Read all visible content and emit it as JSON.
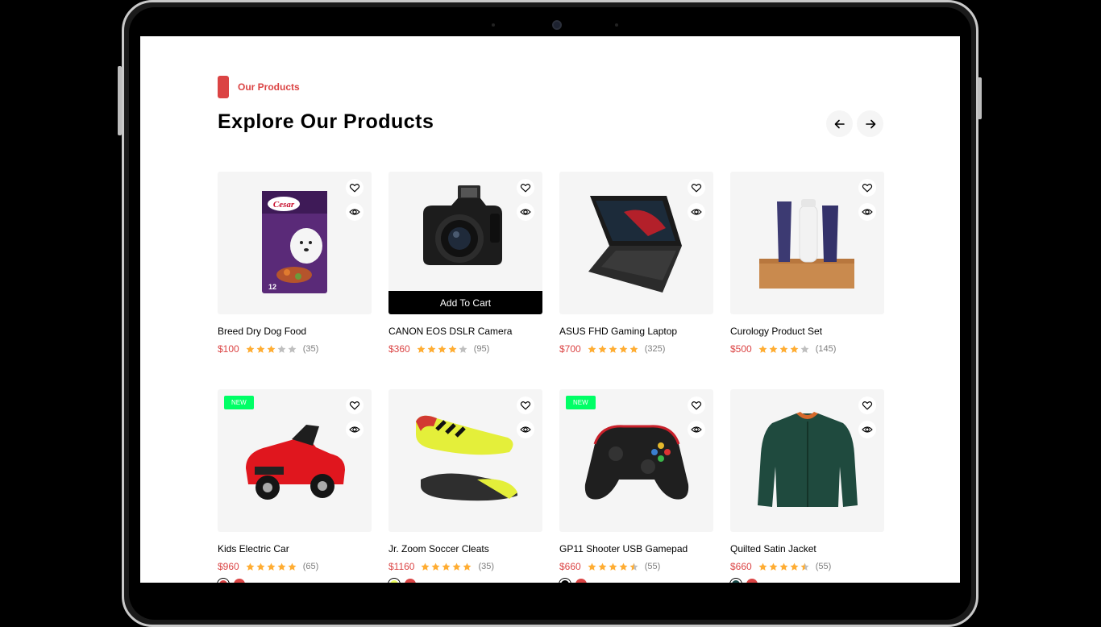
{
  "section": {
    "tag": "Our Products",
    "title": "Explore Our Products"
  },
  "colors": {
    "accent": "#DB4444",
    "badge_new": "#00FF66",
    "star_filled": "#FFAD33",
    "star_empty": "#BFBFBF"
  },
  "products": [
    {
      "name": "Breed Dry Dog Food",
      "price": "$100",
      "rating": 3,
      "reviews": "(35)",
      "badge": "",
      "add_to_cart": "",
      "swatches": []
    },
    {
      "name": "CANON EOS DSLR Camera",
      "price": "$360",
      "rating": 4,
      "reviews": "(95)",
      "badge": "",
      "add_to_cart": "Add To Cart",
      "swatches": []
    },
    {
      "name": "ASUS FHD Gaming Laptop",
      "price": "$700",
      "rating": 5,
      "reviews": "(325)",
      "badge": "",
      "add_to_cart": "",
      "swatches": []
    },
    {
      "name": "Curology Product Set",
      "price": "$500",
      "rating": 4,
      "reviews": "(145)",
      "badge": "",
      "add_to_cart": "",
      "swatches": []
    },
    {
      "name": "Kids Electric Car",
      "price": "$960",
      "rating": 5,
      "reviews": "(65)",
      "badge": "NEW",
      "add_to_cart": "",
      "swatches": [
        "#DB4444",
        "#DB4444"
      ]
    },
    {
      "name": "Jr. Zoom Soccer Cleats",
      "price": "$1160",
      "rating": 5,
      "reviews": "(35)",
      "badge": "",
      "add_to_cart": "",
      "swatches": [
        "#EEFF61",
        "#DB4444"
      ]
    },
    {
      "name": "GP11 Shooter USB Gamepad",
      "price": "$660",
      "rating": 4.5,
      "reviews": "(55)",
      "badge": "NEW",
      "add_to_cart": "",
      "swatches": [
        "#000000",
        "#DB4444"
      ]
    },
    {
      "name": "Quilted Satin Jacket",
      "price": "$660",
      "rating": 4.5,
      "reviews": "(55)",
      "badge": "",
      "add_to_cart": "",
      "swatches": [
        "#184A48",
        "#DB4444"
      ]
    }
  ],
  "icons": {
    "prev": "arrow-left-icon",
    "next": "arrow-right-icon",
    "wishlist": "heart-icon",
    "quick_view": "eye-icon"
  }
}
